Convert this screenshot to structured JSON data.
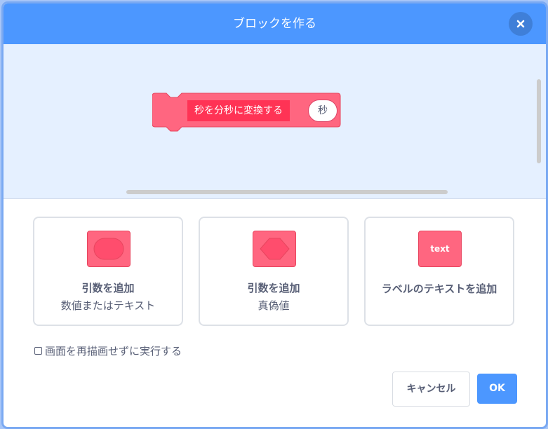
{
  "dialog": {
    "title": "ブロックを作る"
  },
  "block": {
    "label": "秒を分秒に変換する",
    "argument": "秒"
  },
  "options": [
    {
      "title": "引数を追加",
      "subtitle": "数値またはテキスト"
    },
    {
      "title": "引数を追加",
      "subtitle": "真偽値"
    },
    {
      "title": "ラベルのテキストを追加",
      "icon_text": "text"
    }
  ],
  "run_without_refresh": {
    "label": "画面を再描画せずに実行する",
    "checked": false
  },
  "buttons": {
    "cancel": "キャンセル",
    "ok": "OK"
  },
  "colors": {
    "header": "#4c97ff",
    "workspace": "#e5f0ff",
    "block": "#ff6680",
    "block_label": "#ff3355",
    "text": "#575e75"
  },
  "icons": {
    "close": "close-icon",
    "number_text_input": "rounded-input-icon",
    "boolean_input": "hexagon-input-icon",
    "label_text": "text-label-icon"
  }
}
